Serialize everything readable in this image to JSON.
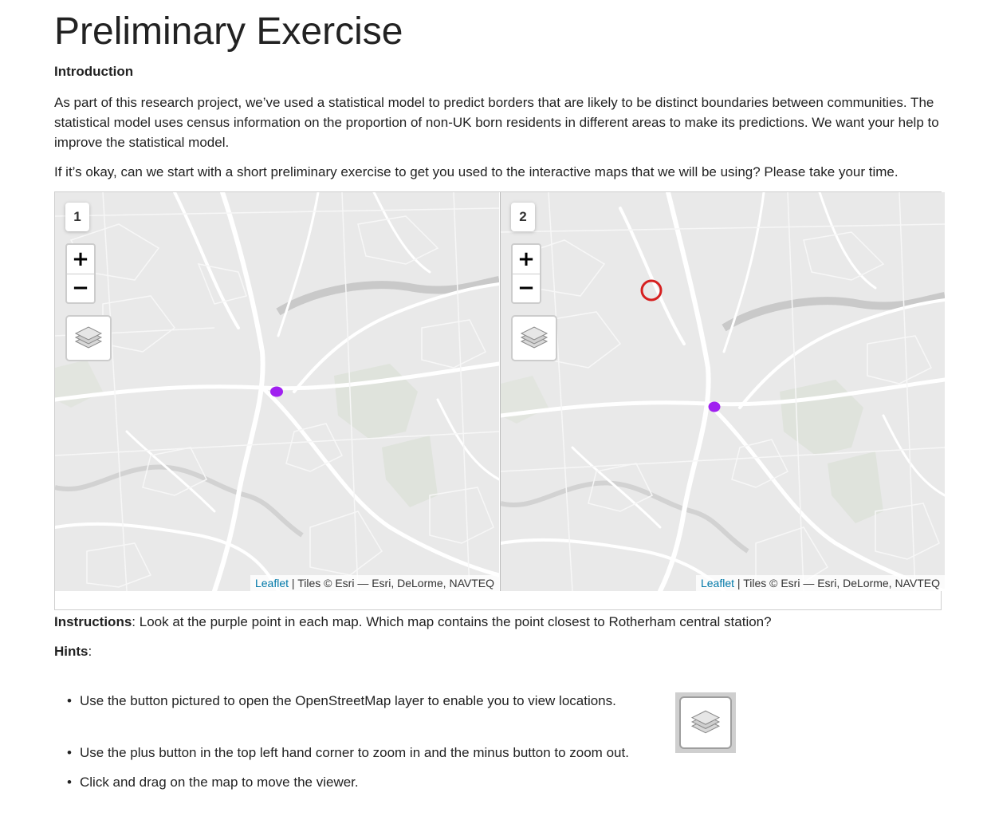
{
  "page": {
    "title": "Preliminary Exercise",
    "intro_heading": "Introduction",
    "intro_paragraph": "As part of this research project, we’ve used a statistical model to predict borders that are likely to be distinct boundaries between communities. The statistical model uses census information on the proportion of non-UK born residents in different areas to make its predictions. We want your help to improve the statistical model.",
    "prompt_paragraph": "If it’s okay, can we start with a short preliminary exercise to get you used to the interactive maps that we will be using? Please take your time."
  },
  "maps": [
    {
      "number": "1",
      "zoom_in": "+",
      "zoom_out": "−",
      "attribution_link": "Leaflet",
      "attribution_text": " | Tiles © Esri — Esri, DeLorme, NAVTEQ",
      "point_color": "#a020f0",
      "has_red_ring": false
    },
    {
      "number": "2",
      "zoom_in": "+",
      "zoom_out": "−",
      "attribution_link": "Leaflet",
      "attribution_text": " | Tiles © Esri — Esri, DeLorme, NAVTEQ",
      "point_color": "#a020f0",
      "has_red_ring": true,
      "ring_color": "#d62020"
    }
  ],
  "instructions": {
    "label": "Instructions",
    "text": ": Look at the purple point in each map. Which map contains the point closest to Rotherham central station?"
  },
  "hints": {
    "label": "Hints",
    "suffix": ":",
    "items": [
      "Use the button pictured to open the OpenStreetMap layer to enable you to view locations.",
      "Use the plus button in the top left hand corner to zoom in and the minus button to zoom out.",
      "Click and drag on the map to move the viewer."
    ],
    "bullet": "•",
    "icon": "layers-icon"
  }
}
